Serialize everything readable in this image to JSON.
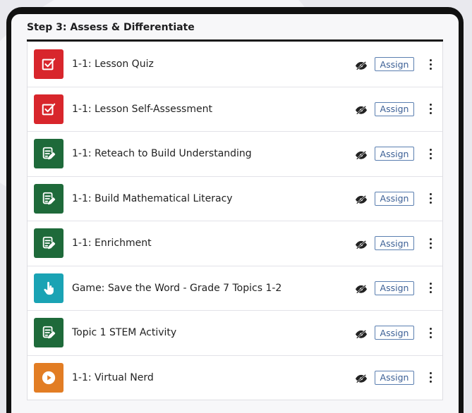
{
  "section": {
    "title": "Step 3: Assess & Differentiate"
  },
  "assign_label": "Assign",
  "colors": {
    "quiz_red": "#d8262c",
    "practice_green": "#1e6a3a",
    "game_teal": "#1aa3b4",
    "video_orange": "#e27d24",
    "assign_border": "#5b7fb0"
  },
  "items": [
    {
      "label": "1-1: Lesson Quiz",
      "icon": "checkbox-icon",
      "color": "#d8262c"
    },
    {
      "label": "1-1: Lesson Self-Assessment",
      "icon": "checkbox-icon",
      "color": "#d8262c"
    },
    {
      "label": "1-1: Reteach to Build Understanding",
      "icon": "edit-document-icon",
      "color": "#1e6a3a"
    },
    {
      "label": "1-1: Build Mathematical Literacy",
      "icon": "edit-document-icon",
      "color": "#1e6a3a"
    },
    {
      "label": "1-1: Enrichment",
      "icon": "edit-document-icon",
      "color": "#1e6a3a"
    },
    {
      "label": "Game: Save the Word  - Grade 7 Topics 1-2",
      "icon": "hand-pointer-icon",
      "color": "#1aa3b4"
    },
    {
      "label": "Topic 1 STEM Activity",
      "icon": "edit-document-icon",
      "color": "#1e6a3a"
    },
    {
      "label": "1-1: Virtual Nerd",
      "icon": "play-icon",
      "color": "#e27d24"
    }
  ]
}
